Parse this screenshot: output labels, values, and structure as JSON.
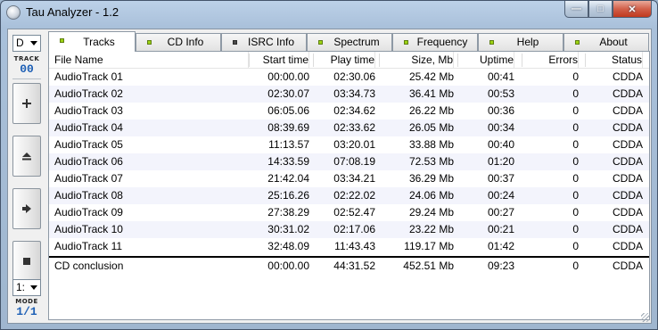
{
  "window": {
    "title": "Tau Analyzer - 1.2",
    "caption_buttons": {
      "minimize": "—",
      "maximize": "□",
      "close": "✕"
    }
  },
  "toolbar": {
    "drive": "D",
    "track_caption": "TRACK",
    "track_number": "00",
    "buttons": [
      "add-icon",
      "eject-icon",
      "play-icon",
      "stop-icon"
    ],
    "mode_select": "1:",
    "mode_caption": "MODE",
    "mode_value": "1/1"
  },
  "tabs": [
    {
      "label": "Tracks",
      "active": true,
      "led": "green"
    },
    {
      "label": "CD Info",
      "active": false,
      "led": "green"
    },
    {
      "label": "ISRC Info",
      "active": false,
      "led": "dark"
    },
    {
      "label": "Spectrum",
      "active": false,
      "led": "green"
    },
    {
      "label": "Frequency",
      "active": false,
      "led": "green"
    },
    {
      "label": "Help",
      "active": false,
      "led": "green"
    },
    {
      "label": "About",
      "active": false,
      "led": "green"
    }
  ],
  "table": {
    "columns": [
      "File Name",
      "Start time",
      "Play time",
      "Size, Mb",
      "Uptime",
      "Errors",
      "Status"
    ],
    "rows": [
      [
        "AudioTrack 01",
        "00:00.00",
        "02:30.06",
        "25.42 Mb",
        "00:41",
        "0",
        "CDDA"
      ],
      [
        "AudioTrack 02",
        "02:30.07",
        "03:34.73",
        "36.41 Mb",
        "00:53",
        "0",
        "CDDA"
      ],
      [
        "AudioTrack 03",
        "06:05.06",
        "02:34.62",
        "26.22 Mb",
        "00:36",
        "0",
        "CDDA"
      ],
      [
        "AudioTrack 04",
        "08:39.69",
        "02:33.62",
        "26.05 Mb",
        "00:34",
        "0",
        "CDDA"
      ],
      [
        "AudioTrack 05",
        "11:13.57",
        "03:20.01",
        "33.88 Mb",
        "00:40",
        "0",
        "CDDA"
      ],
      [
        "AudioTrack 06",
        "14:33.59",
        "07:08.19",
        "72.53 Mb",
        "01:20",
        "0",
        "CDDA"
      ],
      [
        "AudioTrack 07",
        "21:42.04",
        "03:34.21",
        "36.29 Mb",
        "00:37",
        "0",
        "CDDA"
      ],
      [
        "AudioTrack 08",
        "25:16.26",
        "02:22.02",
        "24.06 Mb",
        "00:24",
        "0",
        "CDDA"
      ],
      [
        "AudioTrack 09",
        "27:38.29",
        "02:52.47",
        "29.24 Mb",
        "00:27",
        "0",
        "CDDA"
      ],
      [
        "AudioTrack 10",
        "30:31.02",
        "02:17.06",
        "23.22 Mb",
        "00:21",
        "0",
        "CDDA"
      ],
      [
        "AudioTrack 11",
        "32:48.09",
        "11:43.43",
        "119.17 Mb",
        "01:42",
        "0",
        "CDDA"
      ]
    ],
    "summary": [
      "CD conclusion",
      "00:00.00",
      "44:31.52",
      "452.51 Mb",
      "09:23",
      "0",
      "CDDA"
    ]
  },
  "colors": {
    "led_green": "#9cd313",
    "led_dark": "#4b4b4b",
    "accent_blue": "#1d5fb5",
    "row_alt": "#f3f4fc"
  }
}
